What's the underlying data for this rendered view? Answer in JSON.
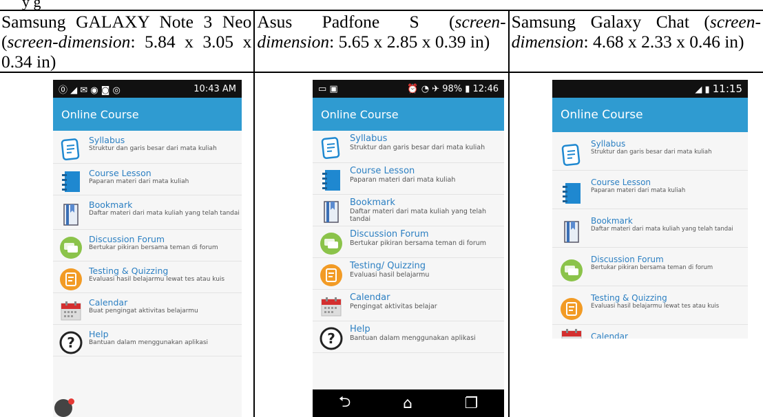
{
  "header_cells": [
    {
      "name_text": "Samsung GALAXY Note 3 Neo (",
      "dim_label": "screen-dimension",
      "dim_text": ": 5.84 x 3.05 x 0.34 in)"
    },
    {
      "name_text": "Asus Padfone S (",
      "dim_label": "screen-dimension",
      "dim_text": ": 5.65 x 2.85 x 0.39 in)"
    },
    {
      "name_text": "Samsung Galaxy Chat (",
      "dim_label": "screen-dimension",
      "dim_text": ": 4.68 x 2.33 x 0.46 in)"
    }
  ],
  "phone1": {
    "status_time": "10:43 AM",
    "title": "Online Course",
    "items": [
      {
        "title": "Syllabus",
        "desc": "Struktur dan garis besar dari mata kuliah",
        "icon": "syllabus-icon"
      },
      {
        "title": "Course Lesson",
        "desc": "Paparan materi dari mata kuliah",
        "icon": "book-icon"
      },
      {
        "title": "Bookmark",
        "desc": "Daftar materi dari mata kuliah yang telah tandai",
        "icon": "bookmark-icon"
      },
      {
        "title": "Discussion Forum",
        "desc": "Bertukar pikiran bersama teman di forum",
        "icon": "chat-icon"
      },
      {
        "title": "Testing & Quizzing",
        "desc": "Evaluasi hasil belajarmu lewat tes atau kuis",
        "icon": "quiz-icon"
      },
      {
        "title": "Calendar",
        "desc": "Buat pengingat aktivitas belajarmu",
        "icon": "calendar-icon"
      },
      {
        "title": "Help",
        "desc": "Bantuan dalam menggunakan aplikasi",
        "icon": "help-icon"
      }
    ]
  },
  "phone2": {
    "status_battery": "98%",
    "status_time": "12:46",
    "title": "Online Course",
    "items": [
      {
        "title": "Syllabus",
        "desc": "Struktur dan garis besar dari mata kuliah",
        "icon": "syllabus-icon"
      },
      {
        "title": "Course Lesson",
        "desc": "Paparan materi dari mata kuliah",
        "icon": "book-icon"
      },
      {
        "title": "Bookmark",
        "desc": "Daftar materi dari mata kuliah yang telah tandai",
        "icon": "bookmark-icon"
      },
      {
        "title": "Discussion Forum",
        "desc": "Bertukar pikiran bersama teman di forum",
        "icon": "chat-icon"
      },
      {
        "title": "Testing/ Quizzing",
        "desc": "Evaluasi hasil belajarmu",
        "icon": "quiz-icon"
      },
      {
        "title": "Calendar",
        "desc": "Pengingat aktivitas belajar",
        "icon": "calendar-icon"
      },
      {
        "title": "Help",
        "desc": "Bantuan dalam menggunakan aplikasi",
        "icon": "help-icon"
      }
    ]
  },
  "phone3": {
    "status_time": "11:15",
    "title": "Online Course",
    "items": [
      {
        "title": "Syllabus",
        "desc": "Struktur dan garis besar dari mata kuliah",
        "icon": "syllabus-icon"
      },
      {
        "title": "Course Lesson",
        "desc": "Paparan materi dari mata kuliah",
        "icon": "book-icon"
      },
      {
        "title": "Bookmark",
        "desc": "Daftar materi dari mata kuliah yang telah tandai",
        "icon": "bookmark-icon"
      },
      {
        "title": "Discussion Forum",
        "desc": "Bertukar pikiran bersama teman di forum",
        "icon": "chat-icon"
      },
      {
        "title": "Testing & Quizzing",
        "desc": "Evaluasi hasil belajarmu lewat tes atau kuis",
        "icon": "quiz-icon"
      },
      {
        "title": "Calendar",
        "desc": "",
        "icon": "calendar-icon"
      }
    ]
  },
  "colors": {
    "appbar": "#2f9bd1",
    "title_text": "#2b7fc2",
    "green": "#8bc34a",
    "orange": "#f29b25",
    "red": "#d32f2f",
    "blue": "#1f88d0"
  }
}
